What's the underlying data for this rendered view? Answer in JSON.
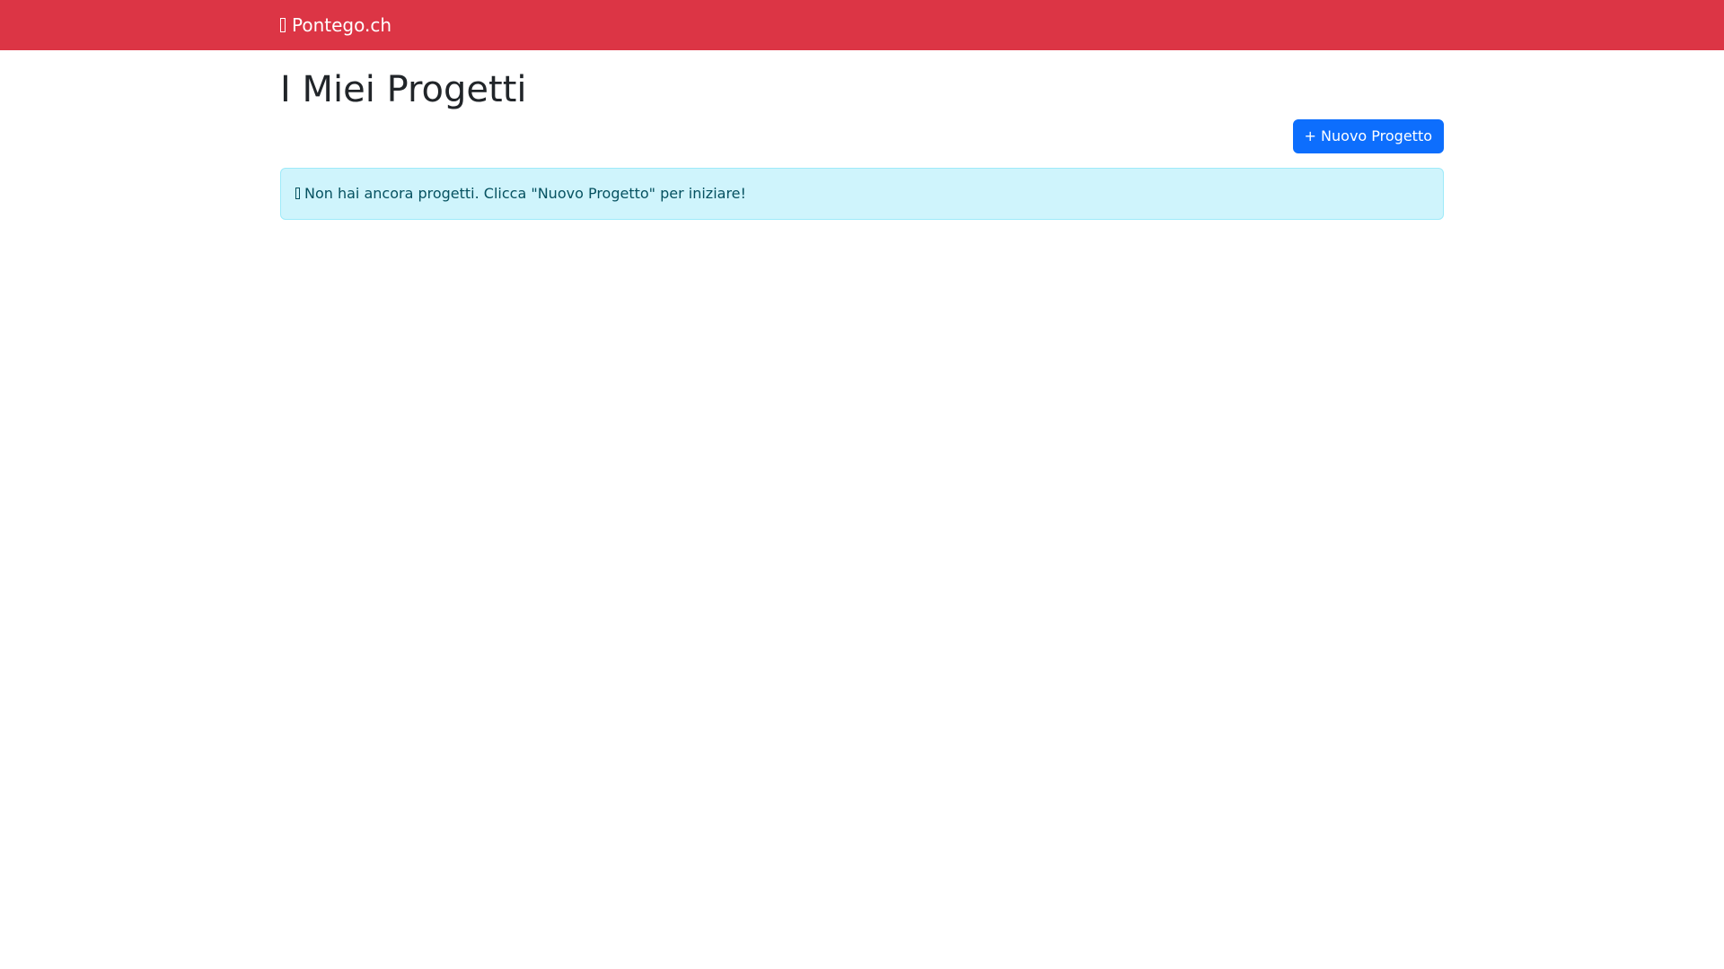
{
  "navbar": {
    "brand_icon": "missing-glyph-icon",
    "brand_label": "Pontego.ch",
    "background_color": "#dc3545"
  },
  "page": {
    "title": "I Miei Progetti"
  },
  "toolbar": {
    "new_project_label": "+ Nuovo Progetto",
    "button_color": "#0d6efd"
  },
  "empty_state": {
    "icon": "missing-glyph-icon",
    "message": "Non hai ancora progetti. Clicca \"Nuovo Progetto\" per iniziare!",
    "background_color": "#cff4fc"
  }
}
